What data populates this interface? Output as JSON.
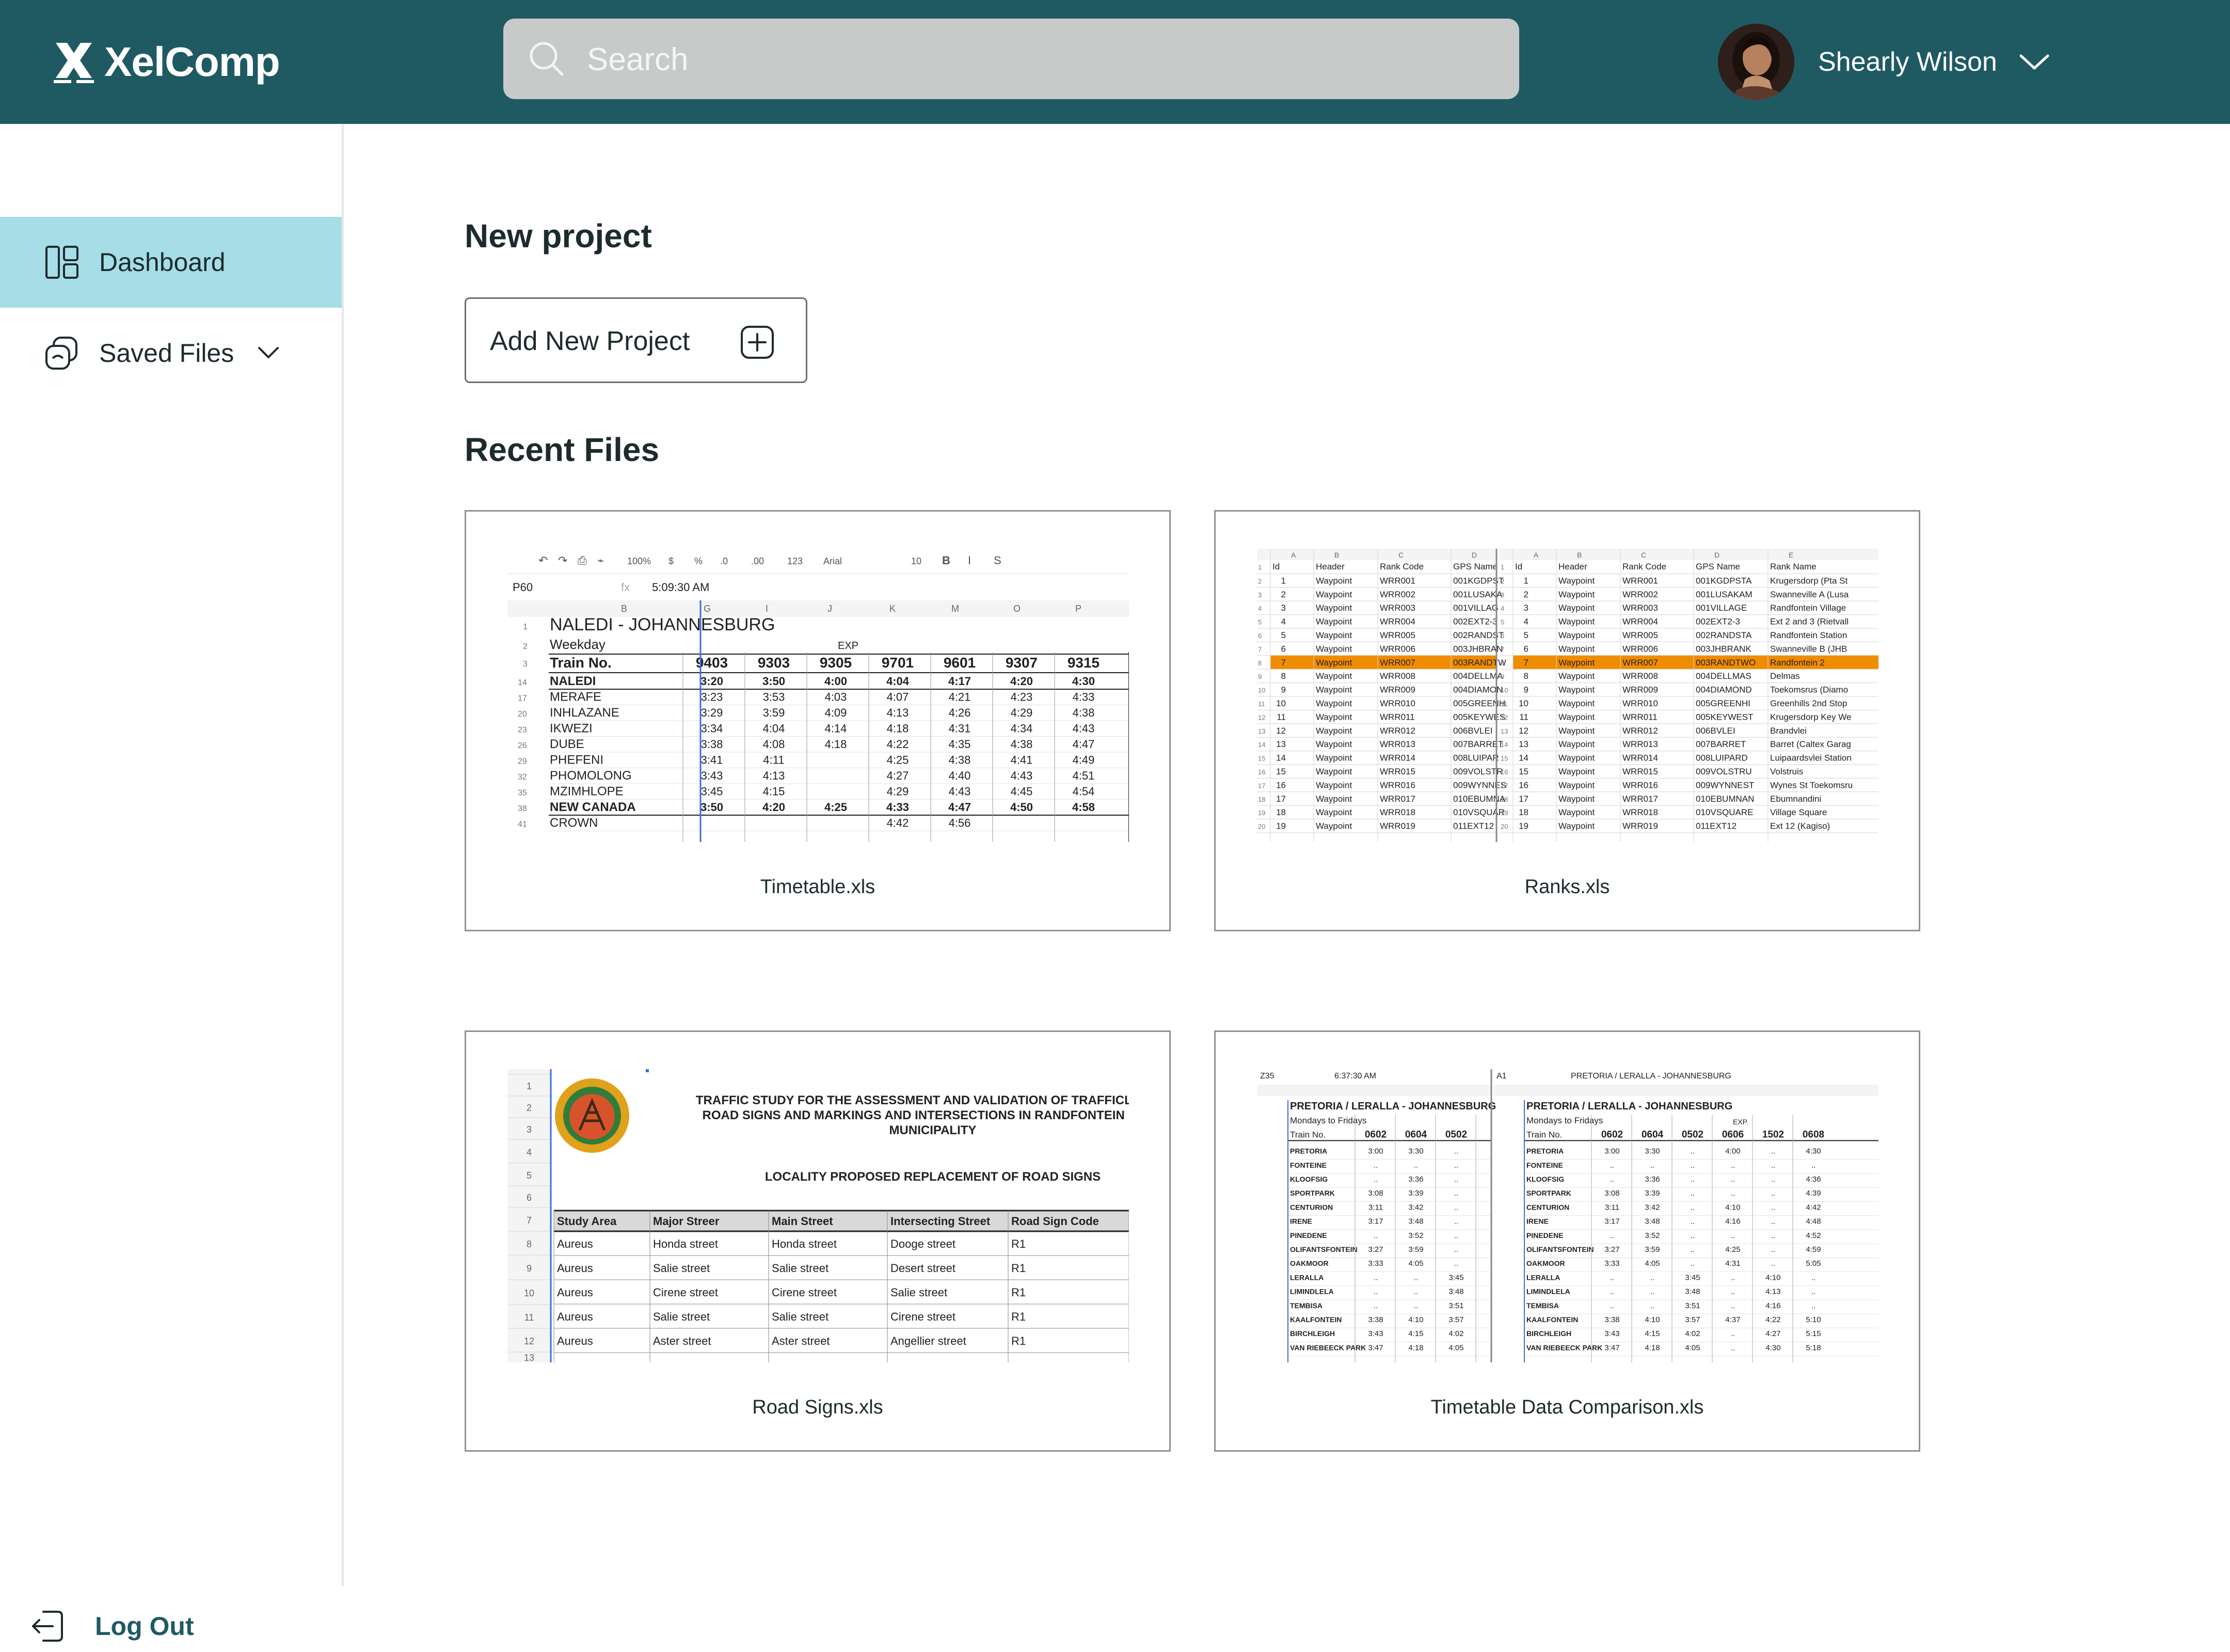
{
  "app": {
    "name": "XelComp",
    "accent": "#1f5a63",
    "active_nav_bg": "#a6dde6"
  },
  "search": {
    "placeholder": "Search",
    "icon": "search-icon"
  },
  "user": {
    "name": "Shearly Wilson"
  },
  "sidebar": {
    "items": [
      {
        "label": "Dashboard",
        "icon": "dashboard-icon",
        "active": true
      },
      {
        "label": "Saved Files",
        "icon": "saved-files-icon",
        "expandable": true
      }
    ],
    "logout_label": "Log Out"
  },
  "main": {
    "new_project_title": "New project",
    "add_button_label": "Add New Project",
    "recent_title": "Recent Files",
    "files": [
      {
        "name": "Timetable.xls"
      },
      {
        "name": "Ranks.xls"
      },
      {
        "name": "Road Signs.xls"
      },
      {
        "name": "Timetable Data Comparison.xls"
      }
    ]
  },
  "thumbs": {
    "timetable": {
      "toolbar": [
        "100%",
        "$",
        "%",
        ".0",
        ".00",
        "123",
        "Arial",
        "10",
        "B",
        "I",
        "S"
      ],
      "cell_ref": "P60",
      "formula": "5:09:30 AM",
      "title": "NALEDI - JOHANNESBURG",
      "weekday": "Weekday",
      "exp": "EXP",
      "train_label": "Train No.",
      "trains": [
        "9403",
        "9303",
        "9305",
        "9701",
        "9601",
        "9307",
        "9315"
      ],
      "rows": [
        {
          "n": "14",
          "s": "NALEDI",
          "t": [
            "3:20",
            "3:50",
            "4:00",
            "4:04",
            "4:17",
            "4:20",
            "4:30"
          ],
          "b": true
        },
        {
          "n": "17",
          "s": "MERAFE",
          "t": [
            "3:23",
            "3:53",
            "4:03",
            "4:07",
            "4:21",
            "4:23",
            "4:33"
          ]
        },
        {
          "n": "20",
          "s": "INHLAZANE",
          "t": [
            "3:29",
            "3:59",
            "4:09",
            "4:13",
            "4:26",
            "4:29",
            "4:38"
          ]
        },
        {
          "n": "23",
          "s": "IKWEZI",
          "t": [
            "3:34",
            "4:04",
            "4:14",
            "4:18",
            "4:31",
            "4:34",
            "4:43"
          ]
        },
        {
          "n": "26",
          "s": "DUBE",
          "t": [
            "3:38",
            "4:08",
            "4:18",
            "4:22",
            "4:35",
            "4:38",
            "4:47"
          ]
        },
        {
          "n": "29",
          "s": "PHEFENI",
          "t": [
            "3:41",
            "4:11",
            "",
            "4:25",
            "4:38",
            "4:41",
            "4:49"
          ]
        },
        {
          "n": "32",
          "s": "PHOMOLONG",
          "t": [
            "3:43",
            "4:13",
            "",
            "4:27",
            "4:40",
            "4:43",
            "4:51"
          ]
        },
        {
          "n": "35",
          "s": "MZIMHLOPE",
          "t": [
            "3:45",
            "4:15",
            "",
            "4:29",
            "4:43",
            "4:45",
            "4:54"
          ]
        },
        {
          "n": "38",
          "s": "NEW CANADA",
          "t": [
            "3:50",
            "4:20",
            "4:25",
            "4:33",
            "4:47",
            "4:50",
            "4:58"
          ],
          "b": true
        },
        {
          "n": "41",
          "s": "CROWN",
          "t": [
            "",
            "",
            "",
            "4:42",
            "4:56",
            "",
            ""
          ]
        }
      ]
    },
    "ranks": {
      "headers": [
        "Id",
        "Header",
        "Rank Code",
        "GPS Name",
        "Rank Name"
      ],
      "rows": [
        [
          "1",
          "Waypoint",
          "WRR001",
          "001KGDPSTA",
          "Krugersdorp (Pta St"
        ],
        [
          "2",
          "Waypoint",
          "WRR002",
          "001LUSAKAM",
          "Swanneville A (Lusa"
        ],
        [
          "3",
          "Waypoint",
          "WRR003",
          "001VILLAGE",
          "Randfontein Village"
        ],
        [
          "4",
          "Waypoint",
          "WRR004",
          "002EXT2-3",
          "Ext 2 and 3 (Rietvall"
        ],
        [
          "5",
          "Waypoint",
          "WRR005",
          "002RANDSTA",
          "Randfontein Station"
        ],
        [
          "6",
          "Waypoint",
          "WRR006",
          "003JHBRANK",
          "Swanneville B (JHB"
        ],
        [
          "7",
          "Waypoint",
          "WRR007",
          "003RANDTWO",
          "Randfontein 2"
        ],
        [
          "8",
          "Waypoint",
          "WRR008",
          "004DELLMAS",
          "Delmas"
        ],
        [
          "9",
          "Waypoint",
          "WRR009",
          "004DIAMOND",
          "Toekomsrus (Diamo"
        ],
        [
          "10",
          "Waypoint",
          "WRR010",
          "005GREENHI",
          "Greenhills 2nd Stop"
        ],
        [
          "11",
          "Waypoint",
          "WRR011",
          "005KEYWEST",
          "Krugersdorp Key We"
        ],
        [
          "12",
          "Waypoint",
          "WRR012",
          "006BVLEI",
          "Brandvlei"
        ],
        [
          "13",
          "Waypoint",
          "WRR013",
          "007BARRET",
          "Barret (Caltex Garag"
        ],
        [
          "14",
          "Waypoint",
          "WRR014",
          "008LUIPARD",
          "Luipaardsvlei Station"
        ],
        [
          "15",
          "Waypoint",
          "WRR015",
          "009VOLSTRU",
          "Volstruis"
        ],
        [
          "16",
          "Waypoint",
          "WRR016",
          "009WYNNEST",
          "Wynes St Toekomsru"
        ],
        [
          "17",
          "Waypoint",
          "WRR017",
          "010EBUMNAN",
          "Ebumnandini"
        ],
        [
          "18",
          "Waypoint",
          "WRR018",
          "010VSQUARE",
          "Village Square"
        ],
        [
          "19",
          "Waypoint",
          "WRR019",
          "011EXT12",
          "Ext 12 (Kagiso)"
        ]
      ],
      "highlight_row": 7
    },
    "signs": {
      "title_lines": [
        "TRAFFIC STUDY FOR THE ASSESSMENT AND VALIDATION OF TRAFFICLIGHTS",
        "ROAD SIGNS AND MARKINGS AND INTERSECTIONS IN RANDFONTEIN LOCA",
        "MUNICIPALITY"
      ],
      "subtitle": "LOCALITY PROPOSED REPLACEMENT OF ROAD SIGNS",
      "headers": [
        "Study Area",
        "Major Streer",
        "Main Street",
        "Intersecting Street",
        "Road Sign Code"
      ],
      "rows": [
        [
          "Aureus",
          "Honda street",
          "Honda street",
          "Dooge street",
          "R1"
        ],
        [
          "Aureus",
          "Salie street",
          "Salie street",
          "Desert street",
          "R1"
        ],
        [
          "Aureus",
          "Cirene street",
          "Cirene street",
          "Salie street",
          "R1"
        ],
        [
          "Aureus",
          "Salie street",
          "Salie street",
          "Cirene street",
          "R1"
        ],
        [
          "Aureus",
          "Aster street",
          "Aster street",
          "Angellier street",
          "R1"
        ]
      ]
    },
    "compare": {
      "left": {
        "cell_ref": "Z35",
        "formula": "6:37:30 AM"
      },
      "right": {
        "cell_ref": "A1",
        "formula": "PRETORIA / LERALLA - JOHANNESBURG"
      },
      "title": "PRETORIA / LERALLA - JOHANNESBURG",
      "subtitle": "Mondays to Fridays",
      "exp": "EXP.",
      "train_label": "Train No.",
      "trains": [
        "0602",
        "0604",
        "0502",
        "0606",
        "1502",
        "0608"
      ],
      "stations": [
        "PRETORIA",
        "FONTEINE",
        "KLOOFSIG",
        "SPORTPARK",
        "CENTURION",
        "IRENE",
        "PINEDENE",
        "OLIFANTSFONTEIN",
        "OAKMOOR",
        "LERALLA",
        "LIMINDLELA",
        "TEMBISA",
        "KAALFONTEIN",
        "BIRCHLEIGH",
        "VAN RIEBEECK PARK"
      ],
      "times": [
        [
          "3:00",
          "3:30",
          "..",
          "4:00",
          "..",
          "4:30"
        ],
        [
          "..",
          "..",
          "..",
          "..",
          "..",
          ".."
        ],
        [
          "..",
          "3:36",
          "..",
          "..",
          "..",
          "4:36"
        ],
        [
          "3:08",
          "3:39",
          "..",
          "..",
          "..",
          "4:39"
        ],
        [
          "3:11",
          "3:42",
          "..",
          "4:10",
          "..",
          "4:42"
        ],
        [
          "3:17",
          "3:48",
          "..",
          "4:16",
          "..",
          "4:48"
        ],
        [
          "..",
          "3:52",
          "..",
          "..",
          "..",
          "4:52"
        ],
        [
          "3:27",
          "3:59",
          "..",
          "4:25",
          "..",
          "4:59"
        ],
        [
          "3:33",
          "4:05",
          "..",
          "4:31",
          "..",
          "5:05"
        ],
        [
          "..",
          "..",
          "3:45",
          "..",
          "4:10",
          ".."
        ],
        [
          "..",
          "..",
          "3:48",
          "..",
          "4:13",
          ".."
        ],
        [
          "..",
          "..",
          "3:51",
          "..",
          "4:16",
          ".."
        ],
        [
          "3:38",
          "4:10",
          "3:57",
          "4:37",
          "4:22",
          "5:10"
        ],
        [
          "3:43",
          "4:15",
          "4:02",
          "..",
          "4:27",
          "5:15"
        ],
        [
          "3:47",
          "4:18",
          "4:05",
          "..",
          "4:30",
          "5:18"
        ]
      ]
    }
  }
}
